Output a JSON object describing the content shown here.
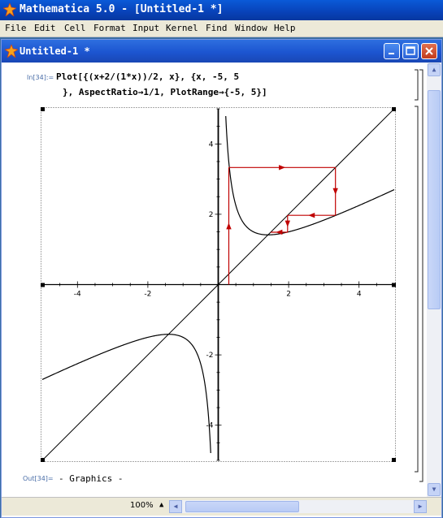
{
  "app": {
    "title": "Mathematica 5.0 - [Untitled-1 *]"
  },
  "menu": {
    "items": [
      "File",
      "Edit",
      "Cell",
      "Format",
      "Input",
      "Kernel",
      "Find",
      "Window",
      "Help"
    ]
  },
  "document": {
    "title": "Untitled-1 *",
    "in_label": "In[34]:=",
    "code_line1": "Plot[{(x+2/(1*x))/2, x}, {x, -5, 5",
    "code_line2": "}, AspectRatio→1/1, PlotRange→{-5, 5}]",
    "out_label": "Out[34]=",
    "out_text": "- Graphics -"
  },
  "status": {
    "zoom": "100%"
  },
  "chart_data": {
    "type": "line",
    "xlim": [
      -5,
      5
    ],
    "ylim": [
      -5,
      5
    ],
    "x_ticks": [
      "-4",
      "-2",
      "2",
      "4"
    ],
    "y_ticks": [
      "4",
      "2",
      "-2",
      "-4"
    ],
    "series": [
      {
        "function": "(x+2/(1*x))/2",
        "color": "#000000"
      },
      {
        "function": "x",
        "color": "#000000"
      }
    ],
    "cobweb": {
      "color": "#c00000",
      "points": [
        [
          0.3,
          0
        ],
        [
          0.3,
          3.33
        ],
        [
          3.33,
          3.33
        ],
        [
          3.33,
          1.97
        ],
        [
          1.97,
          1.97
        ],
        [
          1.97,
          1.49
        ],
        [
          1.49,
          1.49
        ]
      ]
    }
  },
  "colors": {
    "title_bar": "#0842b8",
    "menu_bg": "#ece9d8",
    "label_blue": "#4a6ea8",
    "cobweb": "#c00000"
  }
}
